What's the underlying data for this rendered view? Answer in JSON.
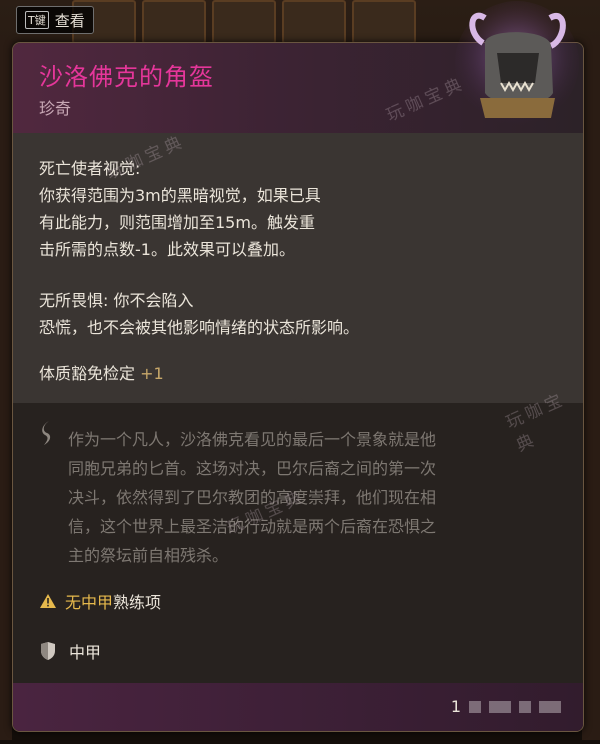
{
  "hud": {
    "key_label": "T键",
    "key_action": "查看"
  },
  "item": {
    "name": "沙洛佛克的角盔",
    "rarity": "珍奇",
    "property1": {
      "title": "死亡使者视觉:",
      "lines": [
        "你获得范围为3m的黑暗视觉，如果已具",
        "有此能力，则范围增加至15m。触发重",
        "击所需的点数-1。此效果可以叠加。"
      ]
    },
    "property2": {
      "title": "无所畏惧: 你不会陷入",
      "line2": "恐慌，也不会被其他影响情绪的状态所影响。"
    },
    "saving_throw": {
      "label": "体质豁免检定",
      "bonus": "+1"
    },
    "lore": [
      "作为一个凡人，沙洛佛克看见的最后一个景象就是他",
      "同胞兄弟的匕首。这场对决，巴尔后裔之间的第一次",
      "决斗，依然得到了巴尔教团的高度崇拜，他们现在相",
      "信，这个世界上最圣洁的行动就是两个后裔在恐惧之",
      "主的祭坛前自相残杀。"
    ],
    "proficiency": {
      "highlight": "无中甲",
      "rest": "熟练项"
    },
    "armor_type": "中甲",
    "price_prefix": "1"
  },
  "watermarks": [
    "玩咖宝典",
    "玩咖宝典",
    "玩咖宝典",
    "玩咖宝典"
  ],
  "icons": {
    "helmet": "horned-helmet-icon",
    "lore": "quill-icon",
    "warning": "warning-icon",
    "armor": "shield-icon"
  },
  "colors": {
    "title": "#e5369a",
    "rarity": "#c9a9b6",
    "proficiency_warning": "#e6b94c",
    "bonus": "#c8a86a"
  }
}
